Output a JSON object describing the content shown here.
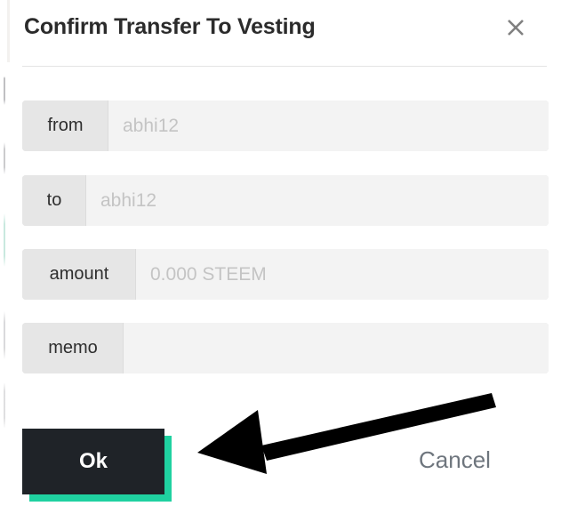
{
  "modal": {
    "title": "Confirm Transfer To Vesting",
    "close_icon": "close-icon"
  },
  "form": {
    "fields": [
      {
        "label": "from",
        "value": "",
        "placeholder": "abhi12"
      },
      {
        "label": "to",
        "value": "",
        "placeholder": "abhi12"
      },
      {
        "label": "amount",
        "value": "",
        "placeholder": "0.000 STEEM"
      },
      {
        "label": "memo",
        "value": "",
        "placeholder": ""
      }
    ]
  },
  "footer": {
    "ok_label": "Ok",
    "cancel_label": "Cancel"
  },
  "annotation": {
    "arrow_icon": "left-pointing-arrow-icon",
    "arrow_color": "#000000"
  },
  "colors": {
    "accent_teal": "#1fd1a0",
    "button_dark": "#1f2328",
    "title_text": "#2b2b2b",
    "placeholder_text": "#c4c4c4",
    "label_bg": "#e6e6e6",
    "input_bg": "#f3f3f3",
    "cancel_text": "#6e757d"
  }
}
